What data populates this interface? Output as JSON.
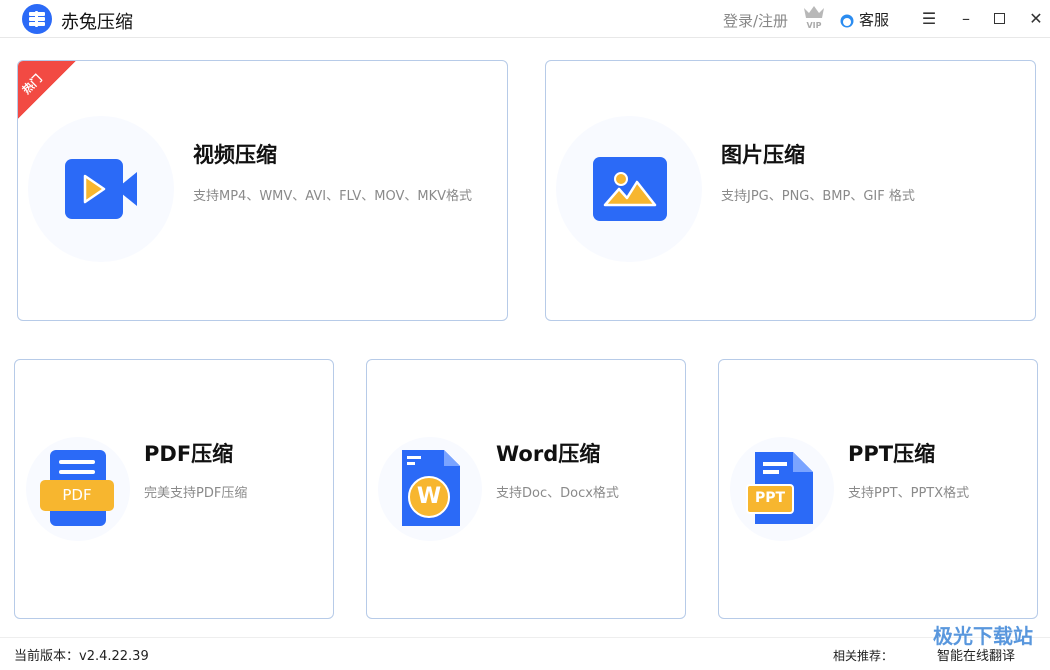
{
  "app": {
    "title": "赤兔压缩"
  },
  "header": {
    "login": "登录/注册",
    "vip": "VIP",
    "service": "客服"
  },
  "cards": [
    {
      "title": "视频压缩",
      "desc": "支持MP4、WMV、AVI、FLV、MOV、MKV格式",
      "badge": "热门"
    },
    {
      "title": "图片压缩",
      "desc": "支持JPG、PNG、BMP、GIF 格式"
    },
    {
      "title": "PDF压缩",
      "desc": "完美支持PDF压缩",
      "icon_text": "PDF"
    },
    {
      "title": "Word压缩",
      "desc": "支持Doc、Docx格式",
      "icon_text": "W"
    },
    {
      "title": "PPT压缩",
      "desc": "支持PPT、PPTX格式",
      "icon_text": "PPT"
    }
  ],
  "footer": {
    "version": "当前版本：v2.4.22.39",
    "recommend_label": "相关推荐：",
    "recommend_link": "智能在线翻译",
    "watermark": "极光下载站"
  },
  "colors": {
    "primary": "#2b6af7",
    "accent": "#f7b62f",
    "hot": "#f24a43",
    "border": "#b7cbe8"
  }
}
